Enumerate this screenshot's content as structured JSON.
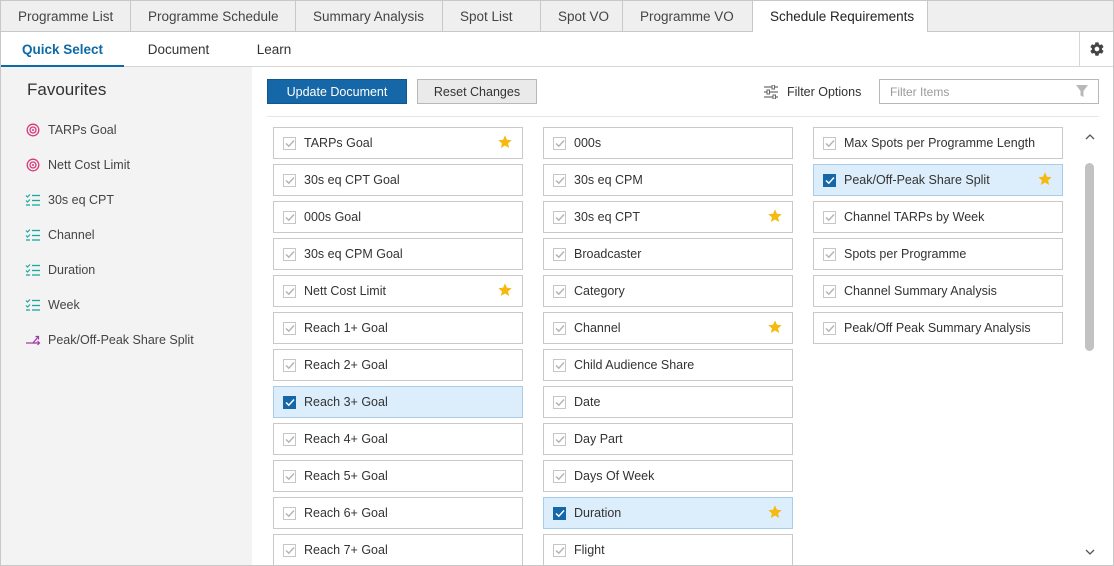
{
  "top_tabs": [
    "Programme List",
    "Programme Schedule",
    "Summary Analysis",
    "Spot List",
    "Spot VO",
    "Programme VO",
    "Schedule Requirements"
  ],
  "active_top_tab": "Schedule Requirements",
  "sub_tabs": [
    "Quick Select",
    "Document",
    "Learn"
  ],
  "active_sub_tab": "Quick Select",
  "sidebar": {
    "title": "Favourites",
    "items": [
      {
        "label": "TARPs Goal",
        "icon": "target-icon"
      },
      {
        "label": "Nett Cost Limit",
        "icon": "target-icon"
      },
      {
        "label": "30s eq CPT",
        "icon": "checklist-icon"
      },
      {
        "label": "Channel",
        "icon": "checklist-icon"
      },
      {
        "label": "Duration",
        "icon": "checklist-icon"
      },
      {
        "label": "Week",
        "icon": "checklist-icon"
      },
      {
        "label": "Peak/Off-Peak Share Split",
        "icon": "split-icon"
      }
    ]
  },
  "toolbar": {
    "update_label": "Update Document",
    "reset_label": "Reset Changes",
    "filter_options_label": "Filter Options",
    "filter_placeholder": "Filter Items"
  },
  "columns": [
    [
      {
        "label": "TARPs Goal",
        "checked": false,
        "star": true
      },
      {
        "label": "30s eq CPT Goal",
        "checked": false,
        "star": false
      },
      {
        "label": "000s Goal",
        "checked": false,
        "star": false
      },
      {
        "label": "30s eq CPM Goal",
        "checked": false,
        "star": false
      },
      {
        "label": "Nett Cost Limit",
        "checked": false,
        "star": true
      },
      {
        "label": "Reach 1+ Goal",
        "checked": false,
        "star": false
      },
      {
        "label": "Reach 2+ Goal",
        "checked": false,
        "star": false
      },
      {
        "label": "Reach 3+ Goal",
        "checked": true,
        "star": false
      },
      {
        "label": "Reach 4+ Goal",
        "checked": false,
        "star": false
      },
      {
        "label": "Reach 5+ Goal",
        "checked": false,
        "star": false
      },
      {
        "label": "Reach 6+ Goal",
        "checked": false,
        "star": false
      },
      {
        "label": "Reach 7+ Goal",
        "checked": false,
        "star": false
      }
    ],
    [
      {
        "label": "000s",
        "checked": false,
        "star": false
      },
      {
        "label": "30s eq CPM",
        "checked": false,
        "star": false
      },
      {
        "label": "30s eq CPT",
        "checked": false,
        "star": true
      },
      {
        "label": "Broadcaster",
        "checked": false,
        "star": false
      },
      {
        "label": "Category",
        "checked": false,
        "star": false
      },
      {
        "label": "Channel",
        "checked": false,
        "star": true
      },
      {
        "label": "Child Audience Share",
        "checked": false,
        "star": false
      },
      {
        "label": "Date",
        "checked": false,
        "star": false
      },
      {
        "label": "Day Part",
        "checked": false,
        "star": false
      },
      {
        "label": "Days Of Week",
        "checked": false,
        "star": false
      },
      {
        "label": "Duration",
        "checked": true,
        "star": true
      },
      {
        "label": "Flight",
        "checked": false,
        "star": false
      }
    ],
    [
      {
        "label": "Max Spots per Programme Length",
        "checked": false,
        "star": false
      },
      {
        "label": "Peak/Off-Peak Share Split",
        "checked": true,
        "star": true
      },
      {
        "label": "Channel TARPs by Week",
        "checked": false,
        "star": false
      },
      {
        "label": "Spots per Programme",
        "checked": false,
        "star": false
      },
      {
        "label": "Channel Summary Analysis",
        "checked": false,
        "star": false
      },
      {
        "label": "Peak/Off Peak Summary Analysis",
        "checked": false,
        "star": false
      }
    ]
  ],
  "colors": {
    "accent": "#0e6aa6",
    "primary_button": "#1567a7",
    "checked_bg": "#dcedfb",
    "star": "#f5b90f",
    "target_icon": "#d63b7a",
    "checklist_icon": "#1aa7a0",
    "split_icon": "#a13ba8"
  }
}
